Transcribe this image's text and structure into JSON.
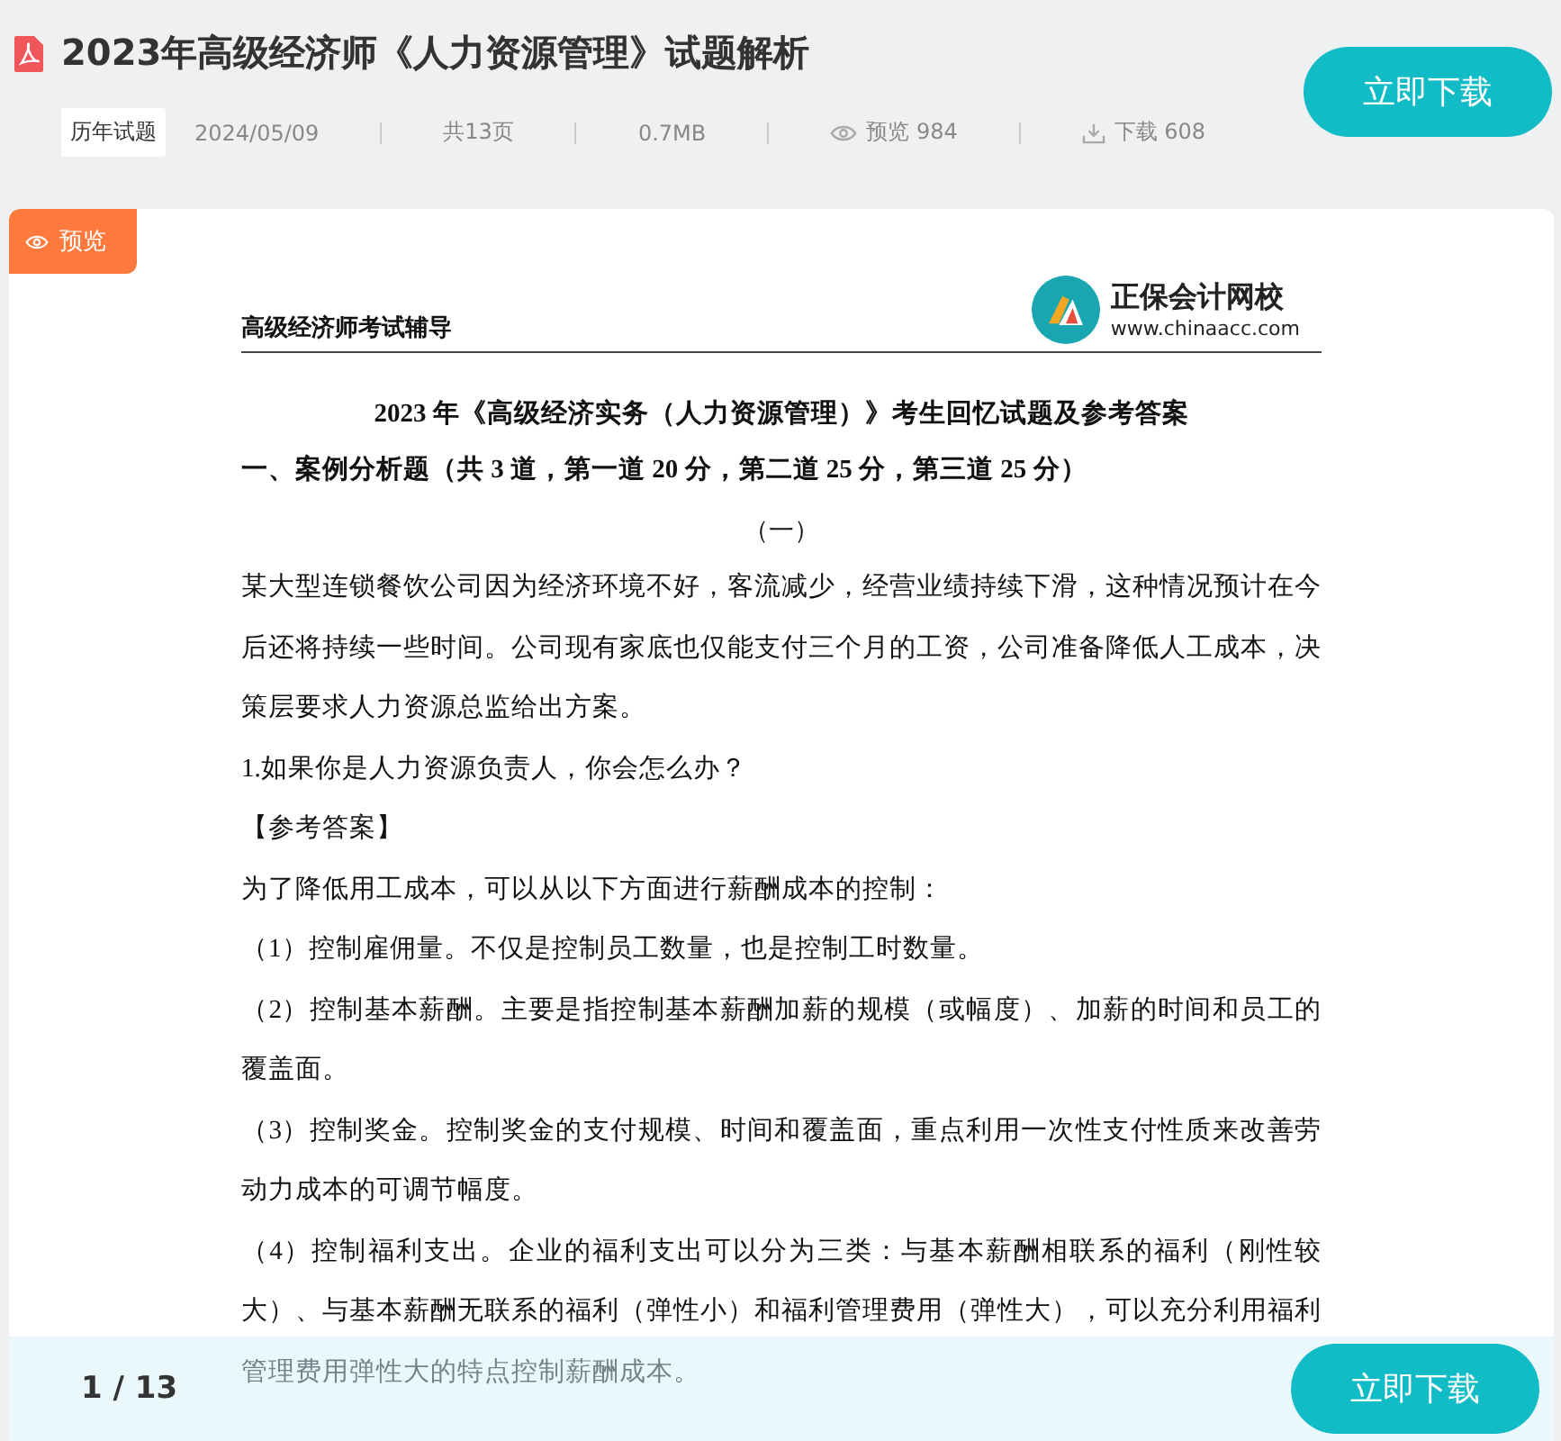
{
  "header": {
    "title": "2023年高级经济师《人力资源管理》试题解析",
    "tag": "历年试题",
    "date": "2024/05/09",
    "pages": "共13页",
    "size": "0.7MB",
    "views": "预览 984",
    "downloads": "下载 608",
    "download_button": "立即下载"
  },
  "preview_badge": "预览",
  "document": {
    "header_left": "高级经济师考试辅导",
    "logo_name": "正保会计网校",
    "logo_url": "www.chinaacc.com",
    "title": "2023 年《高级经济实务（人力资源管理）》考生回忆试题及参考答案",
    "section": "一、案例分析题（共 3 道，第一道 20 分，第二道 25 分，第三道 25 分）",
    "subheading": "（一）",
    "paragraphs": [
      "某大型连锁餐饮公司因为经济环境不好，客流减少，经营业绩持续下滑，这种情况预计在今后还将持续一些时间。公司现有家底也仅能支付三个月的工资，公司准备降低人工成本，决策层要求人力资源总监给出方案。",
      "1.如果你是人力资源负责人，你会怎么办？",
      "【参考答案】",
      "为了降低用工成本，可以从以下方面进行薪酬成本的控制：",
      "（1）控制雇佣量。不仅是控制员工数量，也是控制工时数量。",
      "（2）控制基本薪酬。主要是指控制基本薪酬加薪的规模（或幅度）、加薪的时间和员工的覆盖面。",
      "（3）控制奖金。控制奖金的支付规模、时间和覆盖面，重点利用一次性支付性质来改善劳动力成本的可调节幅度。",
      "（4）控制福利支出。企业的福利支出可以分为三类：与基本薪酬相联系的福利（刚性较大）、与基本薪酬无联系的福利（弹性小）和福利管理费用（弹性大），可以充分利用福利管理费用弹性大的特点控制薪酬成本。"
    ]
  },
  "footer": {
    "page_indicator": "1 / 13",
    "download_button": "立即下载"
  }
}
